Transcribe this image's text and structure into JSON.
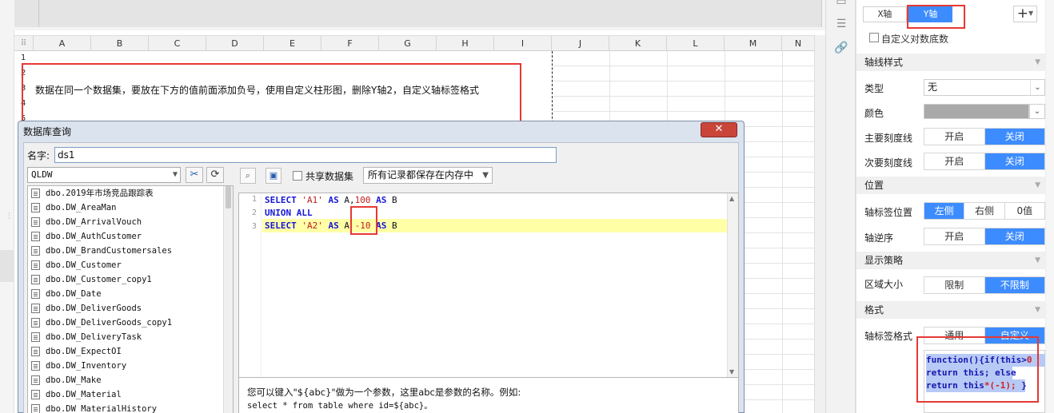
{
  "spreadsheet": {
    "columns": [
      "A",
      "B",
      "C",
      "D",
      "E",
      "F",
      "G",
      "H",
      "I",
      "J",
      "K",
      "L",
      "M",
      "N"
    ],
    "rows": [
      "1",
      "2",
      "3",
      "4",
      "5"
    ],
    "note_text": "数据在同一个数据集，要放在下方的值前面添加负号，使用自定义柱形图，删除Y轴2，自定义轴标签格式"
  },
  "dialog": {
    "title": "数据库查询",
    "close_label": "✕",
    "name_label": "名字:",
    "name_value": "ds1",
    "database": "QLDW",
    "share_label": "共享数据集",
    "memory_option": "所有记录都保存在内存中",
    "tables": [
      "dbo.2019年市场竞品跟踪表",
      "dbo.DW_AreaMan",
      "dbo.DW_ArrivalVouch",
      "dbo.DW_AuthCustomer",
      "dbo.DW_BrandCustomersales",
      "dbo.DW_Customer",
      "dbo.DW_Customer_copy1",
      "dbo.DW_Date",
      "dbo.DW_DeliverGoods",
      "dbo.DW_DeliverGoods_copy1",
      "dbo.DW_DeliveryTask",
      "dbo.DW_ExpectOI",
      "dbo.DW_Inventory",
      "dbo.DW_Make",
      "dbo.DW_Material",
      "dbo.DW_MaterialHistory"
    ],
    "sql": {
      "line_numbers": [
        "1",
        "2",
        "3"
      ],
      "l1": {
        "select": "SELECT ",
        "s1": "'A1'",
        "as1": " AS ",
        "a": "A,",
        "n1": "100",
        "as2": " AS ",
        "b": "B"
      },
      "l2": {
        "union": "UNION ALL"
      },
      "l3": {
        "select": "SELECT ",
        "s2": "'A2'",
        "as1": " AS ",
        "a": "A ",
        "n2": "-10",
        "as2": " AS ",
        "b": "B"
      }
    },
    "help": {
      "line1": "您可以键入\"${abc}\"做为一个参数，这里abc是参数的名称。例如:",
      "line2": "select * from table where id=${abc}。"
    }
  },
  "panel": {
    "x_axis_tab": "X轴",
    "y_axis_tab": "Y轴",
    "add_label": "+",
    "log_base_label": "自定义对数底数",
    "sections": {
      "axis_style": "轴线样式",
      "position": "位置",
      "display": "显示策略",
      "format": "格式"
    },
    "type_label": "类型",
    "type_value": "无",
    "color_label": "颜色",
    "color_value": "#a9a9a9",
    "major_tick_label": "主要刻度线",
    "minor_tick_label": "次要刻度线",
    "on_label": "开启",
    "off_label": "关闭",
    "label_pos_label": "轴标签位置",
    "pos_left": "左侧",
    "pos_right": "右侧",
    "pos_zero": "0值",
    "reverse_label": "轴逆序",
    "area_label": "区域大小",
    "limit_label": "限制",
    "nolimit_label": "不限制",
    "label_format_label": "轴标签格式",
    "fmt_general": "通用",
    "fmt_custom": "自定义",
    "format_code": {
      "l1a": "function(){if(this>",
      "l1b": "0",
      "l2": "return this; else",
      "l3a": "return this",
      "l3b": "*(-1);",
      "l3c": " }"
    }
  },
  "colors": {
    "accent": "#3d8cff",
    "highlight_box": "#e53935"
  }
}
